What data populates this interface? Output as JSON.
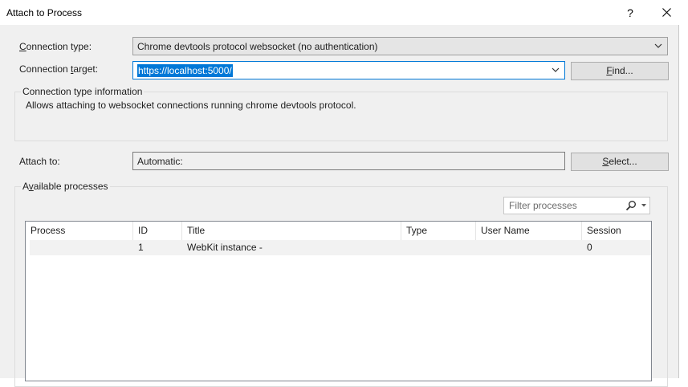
{
  "window": {
    "title": "Attach to Process",
    "help_label": "?"
  },
  "connection_type": {
    "label_prefix": "C",
    "label_rest": "onnection type:",
    "value": "Chrome devtools protocol websocket (no authentication)"
  },
  "connection_target": {
    "label_pre": "Connection ",
    "label_ul": "t",
    "label_post": "arget:",
    "value": "https://localhost:5000/",
    "find_pre": "",
    "find_ul": "F",
    "find_post": "ind..."
  },
  "type_info": {
    "title": "Connection type information",
    "text": "Allows attaching to websocket connections running chrome devtools protocol."
  },
  "attach_to": {
    "label": "Attach to:",
    "value": "Automatic:",
    "select_ul": "S",
    "select_post": "elect..."
  },
  "processes": {
    "title_pre": "A",
    "title_ul": "v",
    "title_post": "ailable processes",
    "filter_placeholder": "Filter processes",
    "columns": [
      "Process",
      "ID",
      "Title",
      "Type",
      "User Name",
      "Session"
    ],
    "rows": [
      {
        "process": "",
        "id": "1",
        "title": "WebKit instance -",
        "type": "",
        "user": "",
        "session": "0"
      }
    ]
  }
}
